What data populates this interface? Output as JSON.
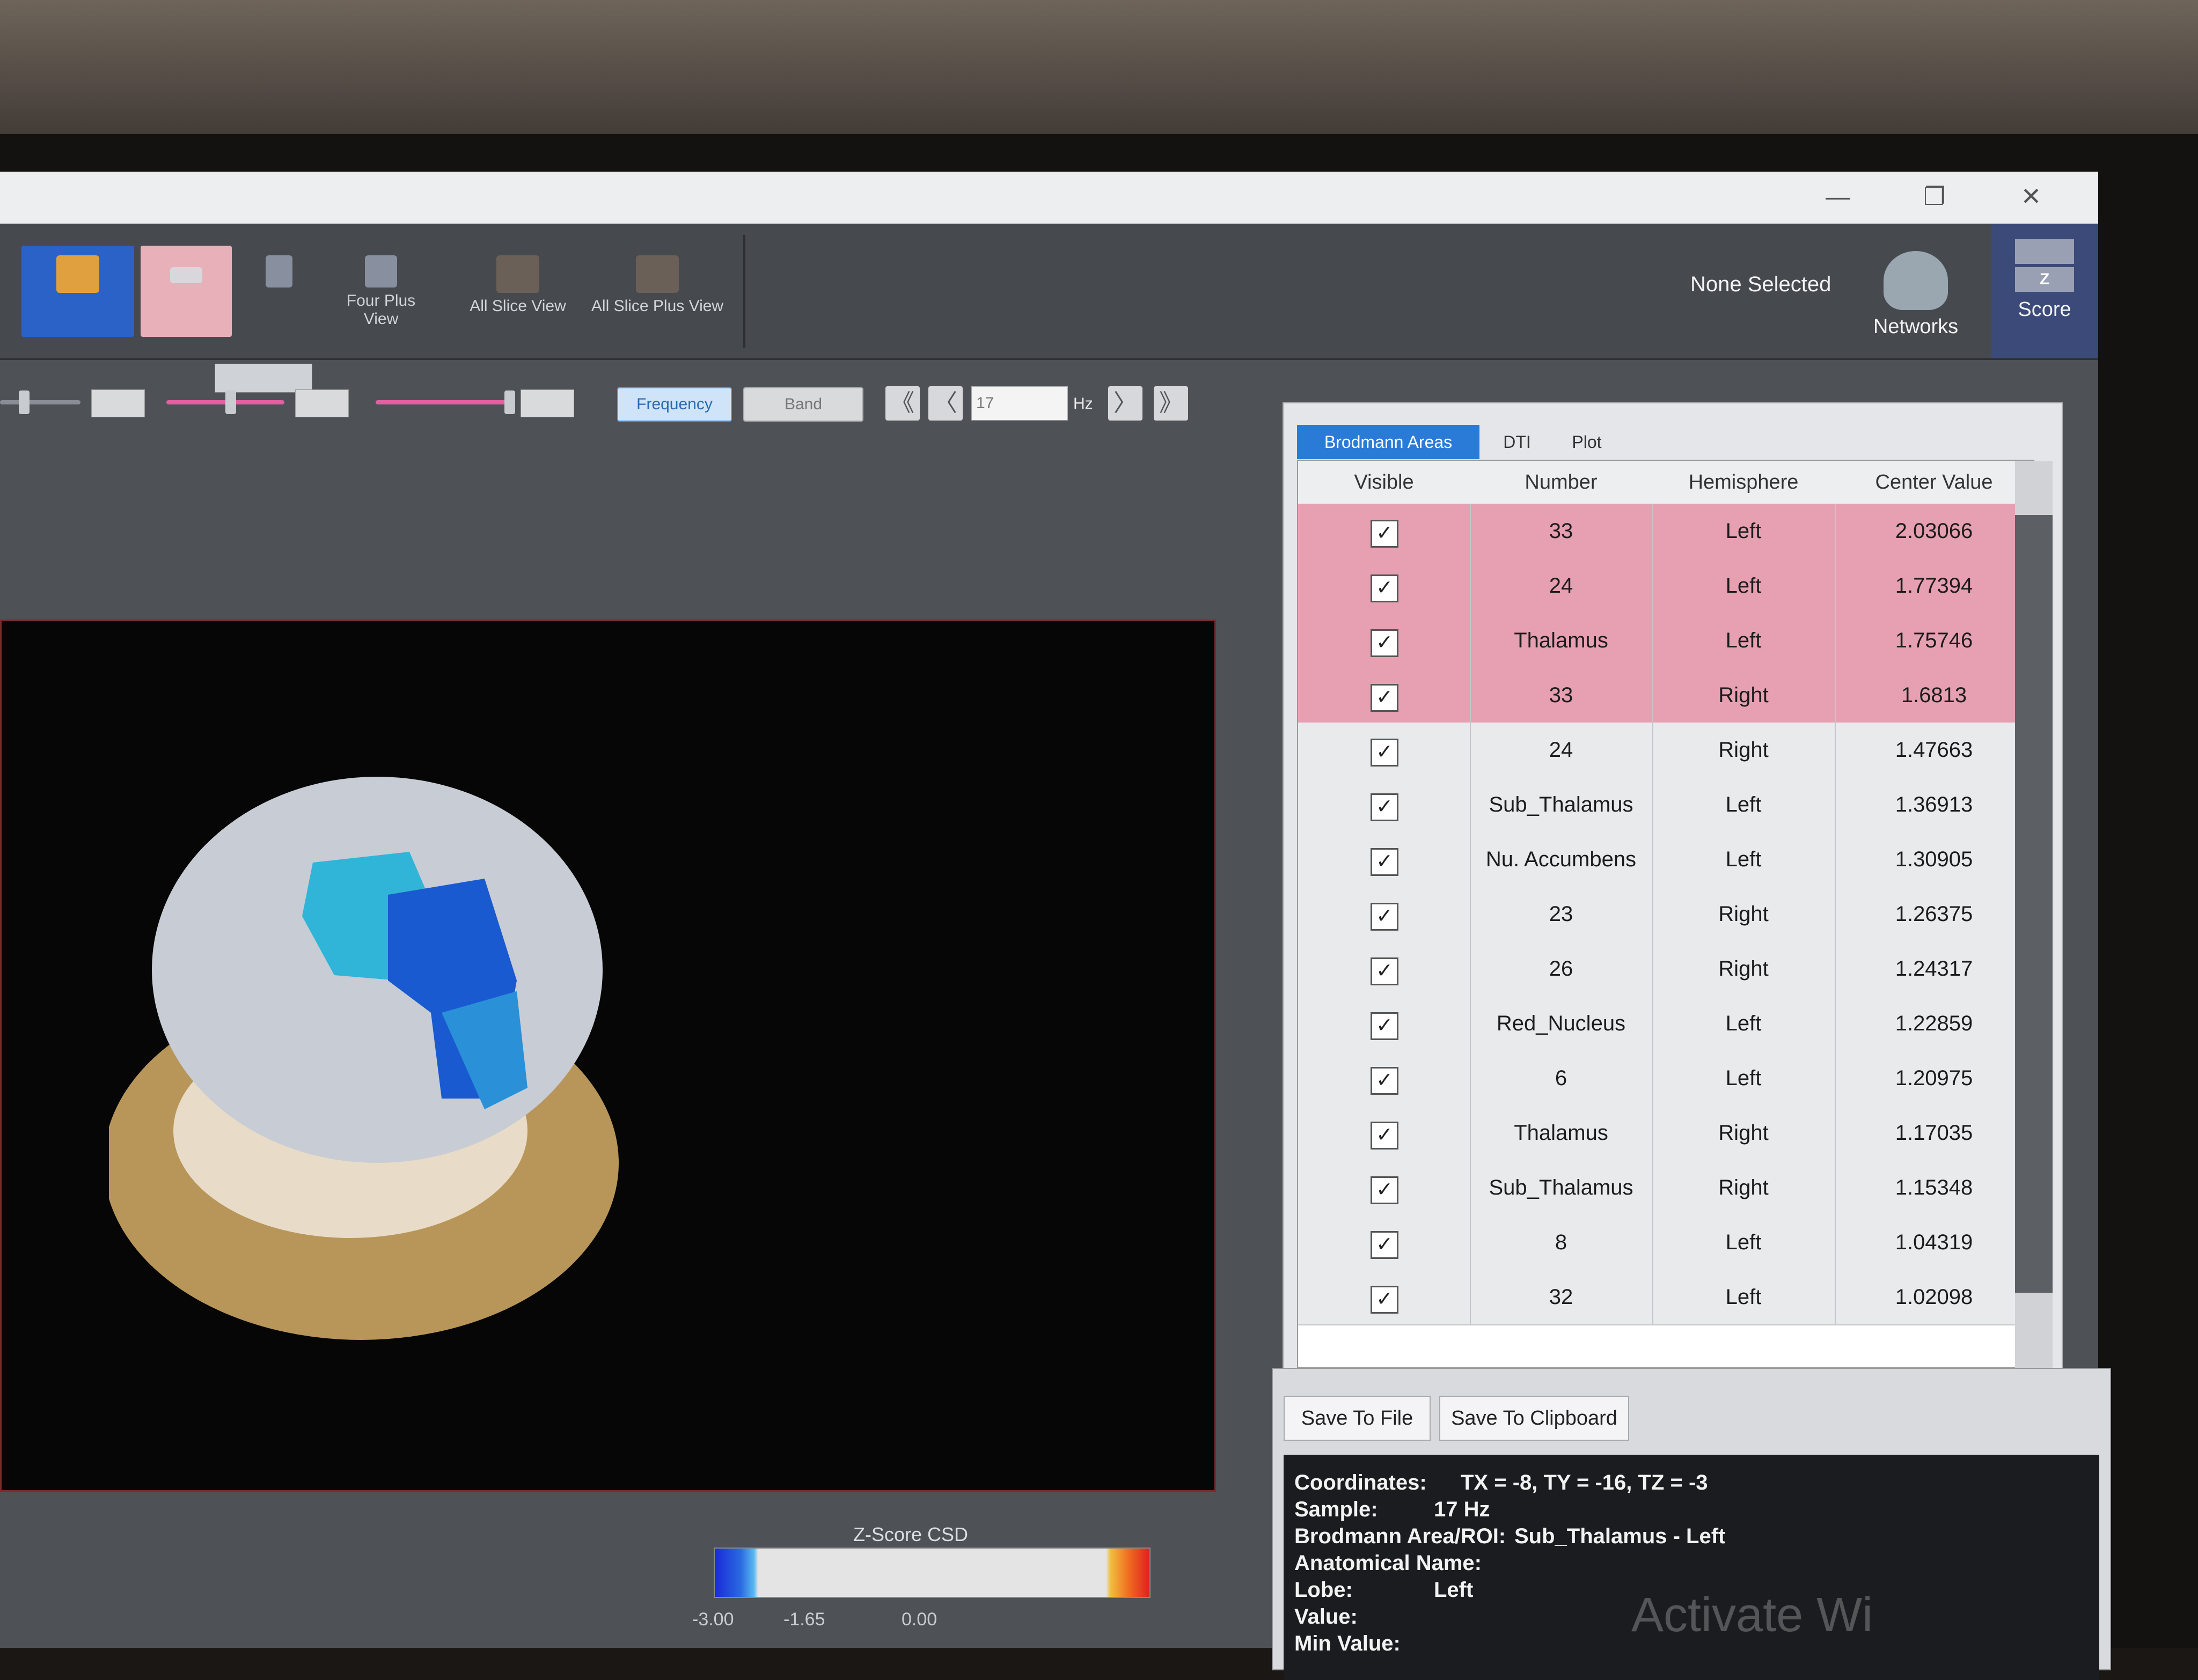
{
  "window": {
    "minimize_glyph": "—",
    "maximize_glyph": "❐",
    "close_glyph": "✕"
  },
  "toolbar": {
    "views": [
      {
        "icon": "volume-view-icon"
      },
      {
        "icon": "three-view-icon"
      },
      {
        "icon": "four-view-icon"
      },
      {
        "label": "Four Plus View",
        "icon": "four-plus-view-icon"
      },
      {
        "label": "All Slice View",
        "icon": "all-slice-view-icon"
      },
      {
        "label": "All Slice Plus View",
        "icon": "all-slice-plus-view-icon"
      }
    ],
    "selection_status": "None Selected",
    "networks_label": "Networks",
    "score_label": "Score",
    "score_toggle_z": "Z"
  },
  "controls": {
    "frequency_label": "Frequency",
    "band_label": "Band",
    "first_glyph": "《",
    "prev_glyph": "〈",
    "hz_value": "17",
    "hz_unit": "Hz",
    "next_glyph": "〉",
    "last_glyph": "》"
  },
  "colorbar": {
    "title": "Z-Score CSD",
    "ticks": [
      "-3.00",
      "-1.65",
      "0.00"
    ]
  },
  "panel": {
    "tabs": [
      "Brodmann Areas",
      "DTI",
      "Plot"
    ],
    "columns": [
      "Visible",
      "Number",
      "Hemisphere",
      "Center Value"
    ],
    "rows": [
      {
        "number": "33",
        "hemisphere": "Left",
        "value": "2.03066",
        "highlight": true
      },
      {
        "number": "24",
        "hemisphere": "Left",
        "value": "1.77394",
        "highlight": true
      },
      {
        "number": "Thalamus",
        "hemisphere": "Left",
        "value": "1.75746",
        "highlight": true
      },
      {
        "number": "33",
        "hemisphere": "Right",
        "value": "1.6813",
        "highlight": true
      },
      {
        "number": "24",
        "hemisphere": "Right",
        "value": "1.47663",
        "highlight": false
      },
      {
        "number": "Sub_Thalamus",
        "hemisphere": "Left",
        "value": "1.36913",
        "highlight": false
      },
      {
        "number": "Nu. Accumbens",
        "hemisphere": "Left",
        "value": "1.30905",
        "highlight": false
      },
      {
        "number": "23",
        "hemisphere": "Right",
        "value": "1.26375",
        "highlight": false
      },
      {
        "number": "26",
        "hemisphere": "Right",
        "value": "1.24317",
        "highlight": false
      },
      {
        "number": "Red_Nucleus",
        "hemisphere": "Left",
        "value": "1.22859",
        "highlight": false
      },
      {
        "number": "6",
        "hemisphere": "Left",
        "value": "1.20975",
        "highlight": false
      },
      {
        "number": "Thalamus",
        "hemisphere": "Right",
        "value": "1.17035",
        "highlight": false
      },
      {
        "number": "Sub_Thalamus",
        "hemisphere": "Right",
        "value": "1.15348",
        "highlight": false
      },
      {
        "number": "8",
        "hemisphere": "Left",
        "value": "1.04319",
        "highlight": false
      },
      {
        "number": "32",
        "hemisphere": "Left",
        "value": "1.02098",
        "highlight": false
      }
    ],
    "checked_glyph": "✓"
  },
  "lower": {
    "save_file_label": "Save To File",
    "save_clipboard_label": "Save To Clipboard",
    "info": {
      "coordinates_label": "Coordinates:",
      "coordinates_value": "TX = -8, TY = -16, TZ = -3",
      "sample_label": "Sample:",
      "sample_value": "17 Hz",
      "roi_label": "Brodmann Area/ROI:",
      "roi_value": "Sub_Thalamus - Left",
      "anatomical_label": "Anatomical Name:",
      "lobe_label": "Lobe:",
      "lobe_value": "Left",
      "value_label": "Value:",
      "min_value_label": "Min Value:"
    }
  },
  "watermark": "Activate Wi"
}
